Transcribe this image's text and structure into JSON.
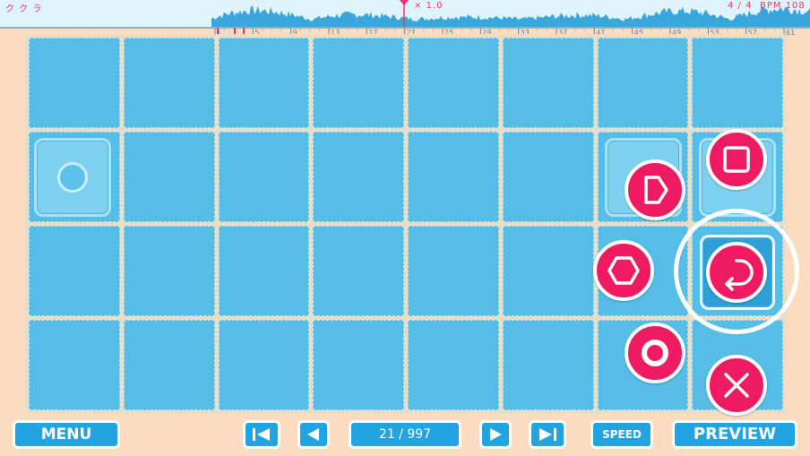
{
  "timeline": {
    "left_glyphs": "ク ク ラ",
    "zoom": "× 1.0",
    "time_signature": "4 / 4",
    "bpm": "BPM 108",
    "ruler_labels": [
      "1",
      "5",
      "9",
      "13",
      "17",
      "21",
      "25",
      "29",
      "33",
      "37",
      "41",
      "45",
      "49",
      "53",
      "57",
      "61"
    ]
  },
  "controls": {
    "menu_label": "MENU",
    "position": "21 / 997",
    "speed_label": "SPEED",
    "preview_label": "PREVIEW"
  },
  "colors": {
    "accent": "#ef1b62",
    "panel": "#56bde6",
    "button": "#21a4e0",
    "background": "#fbdcc0"
  },
  "icons": [
    "first-page-icon",
    "prev-page-icon",
    "next-page-icon",
    "last-page-icon",
    "circle-icon",
    "square-icon",
    "triangle-icon",
    "hexagon-icon",
    "undo-arrow-icon",
    "ring-icon",
    "cross-icon"
  ]
}
